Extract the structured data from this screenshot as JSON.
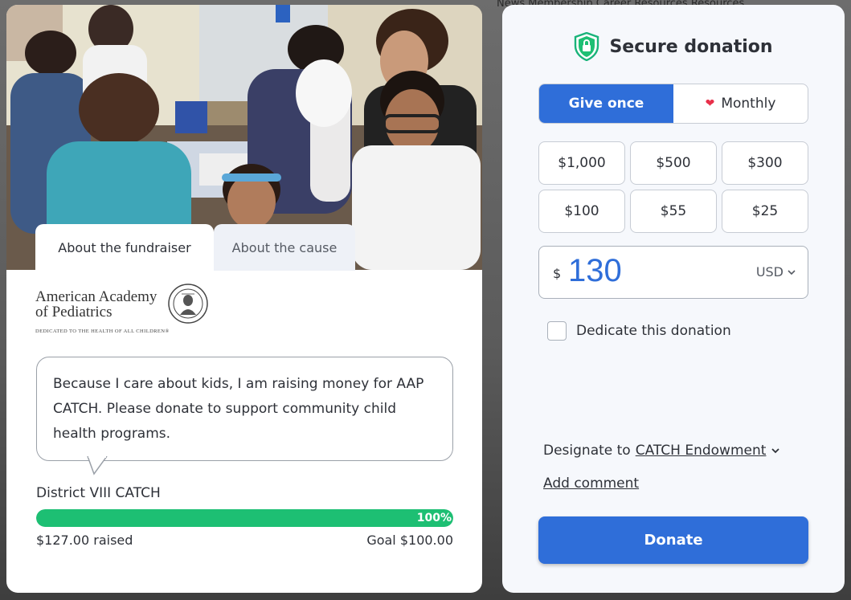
{
  "background": {
    "nav_text": "News   Membership   Career Resources   Resources"
  },
  "left": {
    "tabs": [
      {
        "label": "About the fundraiser",
        "active": true
      },
      {
        "label": "About the cause",
        "active": false
      }
    ],
    "org": {
      "name_line1": "American Academy",
      "name_line2": "of Pediatrics",
      "tagline": "DEDICATED TO THE HEALTH OF ALL CHILDREN®"
    },
    "message": "Because I care about kids, I am raising money for AAP CATCH. Please donate to support community child health programs.",
    "campaign_name": "District VIII CATCH",
    "progress": {
      "percent_label": "100%",
      "fraction": 1.0,
      "raised": "$127.00 raised",
      "goal": "Goal $100.00",
      "color": "#1dbf73"
    }
  },
  "right": {
    "title": "Secure donation",
    "frequency": {
      "once": "Give once",
      "monthly": "Monthly",
      "selected": "once"
    },
    "amount_options": [
      "$1,000",
      "$500",
      "$300",
      "$100",
      "$55",
      "$25"
    ],
    "amount_input": {
      "symbol": "$",
      "value": "130",
      "currency": "USD"
    },
    "dedicate_label": "Dedicate this donation",
    "designate_prefix": "Designate to",
    "designate_value": "CATCH Endowment",
    "add_comment": "Add comment",
    "donate_label": "Donate",
    "accent_color": "#2f6ed9"
  }
}
